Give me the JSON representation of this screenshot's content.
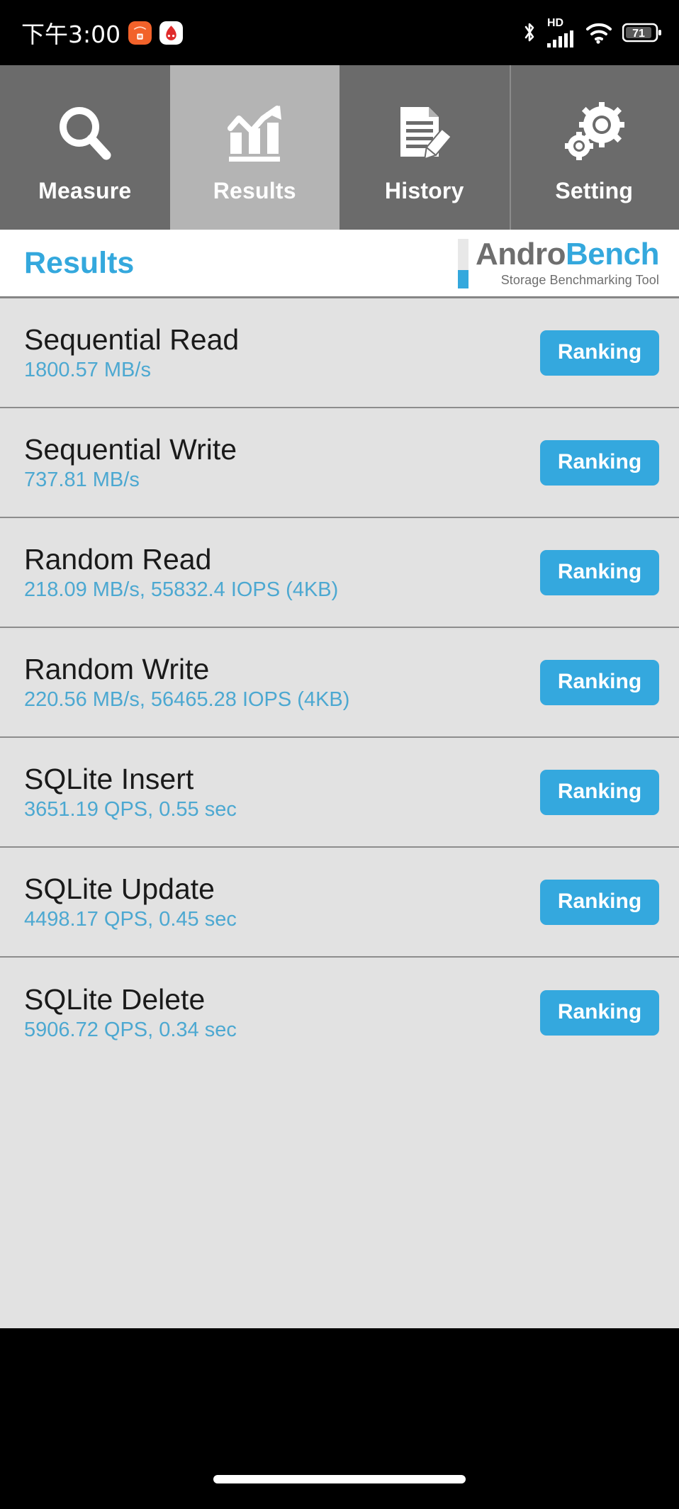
{
  "statusbar": {
    "time": "下午3:00",
    "left_icons": [
      {
        "name": "mi-app-icon",
        "color": "#f2622a"
      },
      {
        "name": "antutu-app-icon",
        "color": "#ffffff"
      }
    ],
    "right_icons": [
      "bluetooth-icon",
      "hd-signal-icon",
      "wifi-icon",
      "battery-icon"
    ],
    "hd_label": "HD",
    "battery_level": "71"
  },
  "tabs": [
    {
      "label": "Measure",
      "icon": "magnifier-icon",
      "active": false
    },
    {
      "label": "Results",
      "icon": "bar-chart-arrow-icon",
      "active": true
    },
    {
      "label": "History",
      "icon": "document-pencil-icon",
      "active": false
    },
    {
      "label": "Setting",
      "icon": "gears-icon",
      "active": false
    }
  ],
  "header": {
    "title": "Results",
    "logo": {
      "word_first": "Andro",
      "word_second": "Bench",
      "tagline": "Storage Benchmarking Tool"
    }
  },
  "results": {
    "ranking_label": "Ranking",
    "rows": [
      {
        "title": "Sequential Read",
        "value": "1800.57 MB/s"
      },
      {
        "title": "Sequential Write",
        "value": "737.81 MB/s"
      },
      {
        "title": "Random Read",
        "value": "218.09 MB/s, 55832.4 IOPS (4KB)"
      },
      {
        "title": "Random Write",
        "value": "220.56 MB/s, 56465.28 IOPS (4KB)"
      },
      {
        "title": "SQLite Insert",
        "value": "3651.19 QPS, 0.55 sec"
      },
      {
        "title": "SQLite Update",
        "value": "4498.17 QPS, 0.45 sec"
      },
      {
        "title": "SQLite Delete",
        "value": "5906.72 QPS, 0.34 sec"
      }
    ]
  },
  "colors": {
    "accent_blue": "#34a8de",
    "value_blue": "#4ca8d1",
    "tab_inactive": "#6b6b6b",
    "tab_active": "#b4b4b4",
    "list_bg": "#e2e2e2",
    "logo_gray": "#6e6e6e"
  }
}
